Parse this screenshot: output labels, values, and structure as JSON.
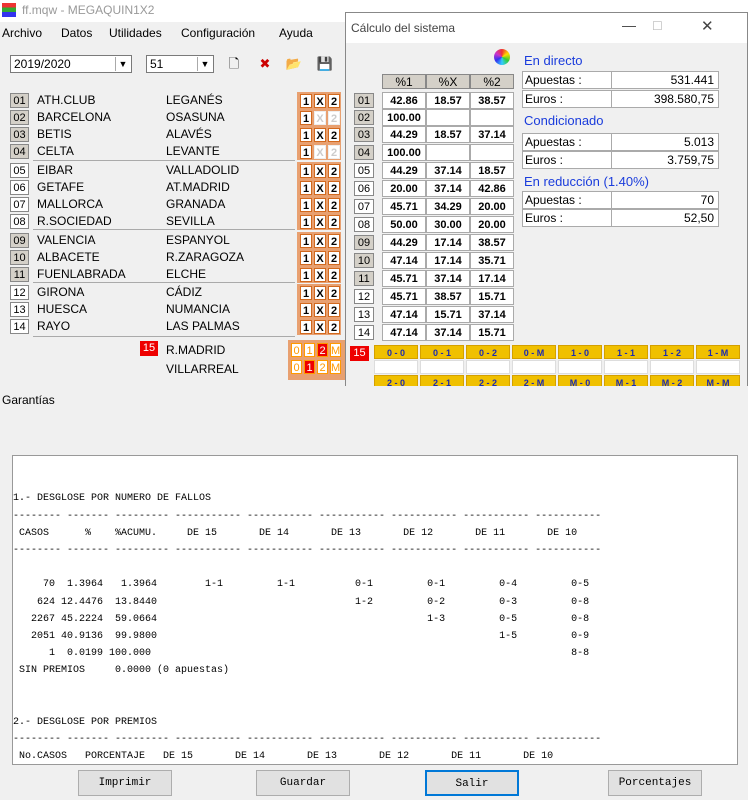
{
  "main": {
    "title": "ff.mqw - MEGAQUIN1X2",
    "menu": [
      "Archivo",
      "Datos",
      "Utilidades",
      "Configuración",
      "Ayuda"
    ],
    "season": "2019/2020",
    "round": "51",
    "matches": [
      {
        "n": "01",
        "home": "ATH.CLUB",
        "away": "LEGANÉS",
        "x12": [
          "1",
          "X",
          "2"
        ],
        "on": [
          1,
          1,
          1
        ]
      },
      {
        "n": "02",
        "home": "BARCELONA",
        "away": "OSASUNA",
        "x12": [
          "1",
          "X",
          "2"
        ],
        "on": [
          1,
          0,
          0
        ]
      },
      {
        "n": "03",
        "home": "BETIS",
        "away": "ALAVÉS",
        "x12": [
          "1",
          "X",
          "2"
        ],
        "on": [
          1,
          1,
          1
        ]
      },
      {
        "n": "04",
        "home": "CELTA",
        "away": "LEVANTE",
        "x12": [
          "1",
          "X",
          "2"
        ],
        "on": [
          1,
          0,
          0
        ]
      },
      {
        "n": "05",
        "home": "EIBAR",
        "away": "VALLADOLID",
        "x12": [
          "1",
          "X",
          "2"
        ],
        "on": [
          1,
          1,
          1
        ]
      },
      {
        "n": "06",
        "home": "GETAFE",
        "away": "AT.MADRID",
        "x12": [
          "1",
          "X",
          "2"
        ],
        "on": [
          1,
          1,
          1
        ]
      },
      {
        "n": "07",
        "home": "MALLORCA",
        "away": "GRANADA",
        "x12": [
          "1",
          "X",
          "2"
        ],
        "on": [
          1,
          1,
          1
        ]
      },
      {
        "n": "08",
        "home": "R.SOCIEDAD",
        "away": "SEVILLA",
        "x12": [
          "1",
          "X",
          "2"
        ],
        "on": [
          1,
          1,
          1
        ]
      },
      {
        "n": "09",
        "home": "VALENCIA",
        "away": "ESPANYOL",
        "x12": [
          "1",
          "X",
          "2"
        ],
        "on": [
          1,
          1,
          1
        ]
      },
      {
        "n": "10",
        "home": "ALBACETE",
        "away": "R.ZARAGOZA",
        "x12": [
          "1",
          "X",
          "2"
        ],
        "on": [
          1,
          1,
          1
        ]
      },
      {
        "n": "11",
        "home": "FUENLABRADA",
        "away": "ELCHE",
        "x12": [
          "1",
          "X",
          "2"
        ],
        "on": [
          1,
          1,
          1
        ]
      },
      {
        "n": "12",
        "home": "GIRONA",
        "away": "CÁDIZ",
        "x12": [
          "1",
          "X",
          "2"
        ],
        "on": [
          1,
          1,
          1
        ]
      },
      {
        "n": "13",
        "home": "HUESCA",
        "away": "NUMANCIA",
        "x12": [
          "1",
          "X",
          "2"
        ],
        "on": [
          1,
          1,
          1
        ]
      },
      {
        "n": "14",
        "home": "RAYO",
        "away": "LAS PALMAS",
        "x12": [
          "1",
          "X",
          "2"
        ],
        "on": [
          1,
          1,
          1
        ]
      }
    ],
    "pleno": {
      "n": "15",
      "home": "R.MADRID",
      "away": "VILLARREAL",
      "home_goals": [
        "0",
        "1",
        "2",
        "M"
      ],
      "away_goals": [
        "0",
        "1",
        "2",
        "M"
      ]
    }
  },
  "calc": {
    "title": "Cálculo del sistema",
    "headers": [
      "%1",
      "%X",
      "%2"
    ],
    "rows": [
      {
        "n": "01",
        "v": [
          "42.86",
          "18.57",
          "38.57"
        ]
      },
      {
        "n": "02",
        "v": [
          "100.00",
          "",
          ""
        ]
      },
      {
        "n": "03",
        "v": [
          "44.29",
          "18.57",
          "37.14"
        ]
      },
      {
        "n": "04",
        "v": [
          "100.00",
          "",
          ""
        ]
      },
      {
        "n": "05",
        "v": [
          "44.29",
          "37.14",
          "18.57"
        ]
      },
      {
        "n": "06",
        "v": [
          "20.00",
          "37.14",
          "42.86"
        ]
      },
      {
        "n": "07",
        "v": [
          "45.71",
          "34.29",
          "20.00"
        ]
      },
      {
        "n": "08",
        "v": [
          "50.00",
          "30.00",
          "20.00"
        ]
      },
      {
        "n": "09",
        "v": [
          "44.29",
          "17.14",
          "38.57"
        ]
      },
      {
        "n": "10",
        "v": [
          "47.14",
          "17.14",
          "35.71"
        ]
      },
      {
        "n": "11",
        "v": [
          "45.71",
          "37.14",
          "17.14"
        ]
      },
      {
        "n": "12",
        "v": [
          "45.71",
          "38.57",
          "15.71"
        ]
      },
      {
        "n": "13",
        "v": [
          "47.14",
          "15.71",
          "37.14"
        ]
      },
      {
        "n": "14",
        "v": [
          "47.14",
          "37.14",
          "15.71"
        ]
      }
    ],
    "directo": {
      "title": "En directo",
      "apuestas_label": "Apuestas :",
      "apuestas": "531.441",
      "euros_label": "Euros :",
      "euros": "398.580,75"
    },
    "condicionado": {
      "title": "Condicionado",
      "apuestas_label": "Apuestas :",
      "apuestas": "5.013",
      "euros_label": "Euros :",
      "euros": "3.759,75"
    },
    "reduccion": {
      "title": "En reducción (1.40%)",
      "apuestas_label": "Apuestas :",
      "apuestas": "70",
      "euros_label": "Euros :",
      "euros": "52,50"
    },
    "pleno_n": "15",
    "goals_row1": [
      "0 - 0",
      "0 - 1",
      "0 - 2",
      "0 - M",
      "1 - 0",
      "1 - 1",
      "1 - 2",
      "1 - M"
    ],
    "goals_row2": [
      "2 - 0",
      "2 - 1",
      "2 - 2",
      "2 - M",
      "M - 0",
      "M - 1",
      "M - 2",
      "M - M"
    ]
  },
  "garantias": {
    "title": "Garantías",
    "report": "\n\n1.- DESGLOSE POR NUMERO DE FALLOS\n-------- ------- --------- ----------- ----------- ----------- ----------- ----------- -----------\n CASOS      %    %ACUMU.     DE 15       DE 14       DE 13       DE 12       DE 11       DE 10\n-------- ------- --------- ----------- ----------- ----------- ----------- ----------- -----------\n\n     70  1.3964   1.3964        1-1         1-1          0-1         0-1         0-4         0-5\n    624 12.4476  13.8440                                 1-2         0-2         0-3         0-8\n   2267 45.2224  59.0664                                             1-3         0-5         0-8\n   2051 40.9136  99.9800                                                         1-5         0-9\n      1  0.0199 100.000                                                                      8-8\n SIN PREMIOS     0.0000 (0 apuestas)\n\n\n2.- DESGLOSE POR PREMIOS\n-------- ------- --------- ----------- ----------- ----------- ----------- ----------- -----------\n No.CASOS   PORCENTAJE   DE 15       DE 14       DE 13       DE 12       DE 11       DE 10\n-------- ------- --------- ----------- ----------- ----------- ----------- ----------- -----------",
    "buttons": {
      "imprimir": "Imprimir",
      "guardar": "Guardar",
      "salir": "Salir",
      "porcentajes": "Porcentajes"
    }
  }
}
